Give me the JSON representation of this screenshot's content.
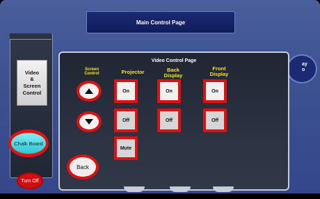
{
  "header": {
    "title": "Main Control Page"
  },
  "sidebar": {
    "video_screen_control_line1": "Video",
    "video_screen_control_line2": "&",
    "video_screen_control_line3": "Screen",
    "video_screen_control_line4": "Control",
    "chalk_board": "Chalk Board",
    "turn_off": "Turn Off"
  },
  "display_pill": {
    "text_line1": "ay",
    "text_line2": "o"
  },
  "dialog": {
    "title": "Video Control Page",
    "columns": {
      "screen_control_line1": "Screen",
      "screen_control_line2": "Control",
      "projector": "Projector",
      "back_display_line1": "Back",
      "back_display_line2": "Display",
      "front_display_line1": "Front",
      "front_display_line2": "Display"
    },
    "projector": {
      "on": "On",
      "off": "Off",
      "mute": "Mute"
    },
    "back_display": {
      "on": "On",
      "off": "Off"
    },
    "front_display": {
      "on": "On",
      "off": "Off"
    },
    "back": "Back"
  },
  "colors": {
    "accent_red": "#e01010",
    "label_yellow": "#f6e51a",
    "chalk_cyan": "#2fc4d2"
  }
}
